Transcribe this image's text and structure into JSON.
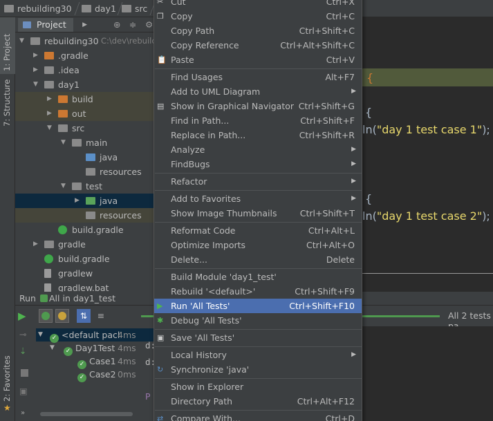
{
  "breadcrumbs": [
    "rebuilding30",
    "day1",
    "src"
  ],
  "tool_windows": {
    "project": "1: Project",
    "structure": "7: Structure",
    "favorites": "2: Favorites"
  },
  "project_panel": {
    "tab_label": "Project",
    "tree": [
      {
        "label": "rebuilding30",
        "path": "C:\\dev\\rebuild",
        "icon": "module-folder-icon"
      },
      {
        "label": ".gradle",
        "icon": "orange-folder-icon"
      },
      {
        "label": ".idea",
        "icon": "folder-icon"
      },
      {
        "label": "day1",
        "icon": "folder-icon"
      },
      {
        "label": "build",
        "icon": "orange-folder-icon"
      },
      {
        "label": "out",
        "icon": "orange-folder-icon"
      },
      {
        "label": "src",
        "icon": "folder-icon"
      },
      {
        "label": "main",
        "icon": "folder-icon"
      },
      {
        "label": "java",
        "icon": "blue-source-folder-icon"
      },
      {
        "label": "resources",
        "icon": "resources-folder-icon"
      },
      {
        "label": "test",
        "icon": "folder-icon"
      },
      {
        "label": "java",
        "icon": "green-test-folder-icon"
      },
      {
        "label": "resources",
        "icon": "resources-folder-icon"
      },
      {
        "label": "build.gradle",
        "icon": "gradle-icon"
      },
      {
        "label": "gradle",
        "icon": "folder-icon"
      },
      {
        "label": "build.gradle",
        "icon": "gradle-icon"
      },
      {
        "label": "gradlew",
        "icon": "file-icon"
      },
      {
        "label": "gradlew.bat",
        "icon": "file-icon"
      }
    ]
  },
  "editor": {
    "lines": [
      {
        "text": "{",
        "kind": "brace-highlight"
      },
      {
        "text": "{",
        "kind": "code"
      },
      {
        "prefix": "ln(",
        "string": "\"day 1 test case 1\"",
        "suffix": ");"
      },
      {
        "text": "{",
        "kind": "code"
      },
      {
        "prefix": "ln(",
        "string": "\"day 1 test case 2\"",
        "suffix": ");"
      }
    ]
  },
  "run_panel": {
    "title_prefix": "Run",
    "title": "All in day1_test",
    "status": "All 2 tests pa",
    "tests": [
      {
        "label": "<default pacl",
        "duration": "4ms"
      },
      {
        "label": "Day1Test",
        "duration": "4ms"
      },
      {
        "label": "Case1",
        "duration": "4ms"
      },
      {
        "label": "Case2",
        "duration": "0ms"
      }
    ],
    "console_lines": [
      "d:",
      "d:",
      "P"
    ]
  },
  "context_menu": {
    "items": [
      {
        "label": "Cut",
        "shortcut": "Ctrl+X",
        "icon": "scissors-icon"
      },
      {
        "label": "Copy",
        "shortcut": "Ctrl+C",
        "icon": "copy-icon"
      },
      {
        "label": "Copy Path",
        "shortcut": "Ctrl+Shift+C"
      },
      {
        "label": "Copy Reference",
        "shortcut": "Ctrl+Alt+Shift+C"
      },
      {
        "label": "Paste",
        "shortcut": "Ctrl+V",
        "icon": "paste-icon"
      },
      {
        "separator": true
      },
      {
        "label": "Find Usages",
        "shortcut": "Alt+F7"
      },
      {
        "label": "Add to UML Diagram",
        "submenu": true
      },
      {
        "label": "Show in Graphical Navigator",
        "shortcut": "Ctrl+Shift+G",
        "icon": "graph-navigator-icon"
      },
      {
        "label": "Find in Path...",
        "shortcut": "Ctrl+Shift+F"
      },
      {
        "label": "Replace in Path...",
        "shortcut": "Ctrl+Shift+R"
      },
      {
        "label": "Analyze",
        "submenu": true
      },
      {
        "label": "FindBugs",
        "submenu": true
      },
      {
        "separator": true
      },
      {
        "label": "Refactor",
        "submenu": true
      },
      {
        "separator": true
      },
      {
        "label": "Add to Favorites",
        "submenu": true
      },
      {
        "label": "Show Image Thumbnails",
        "shortcut": "Ctrl+Shift+T"
      },
      {
        "separator": true
      },
      {
        "label": "Reformat Code",
        "shortcut": "Ctrl+Alt+L"
      },
      {
        "label": "Optimize Imports",
        "shortcut": "Ctrl+Alt+O"
      },
      {
        "label": "Delete...",
        "shortcut": "Delete"
      },
      {
        "separator": true
      },
      {
        "label": "Build Module 'day1_test'"
      },
      {
        "label": "Rebuild '<default>'",
        "shortcut": "Ctrl+Shift+F9"
      },
      {
        "label": "Run 'All Tests'",
        "shortcut": "Ctrl+Shift+F10",
        "icon": "run-icon",
        "selected": true
      },
      {
        "label": "Debug 'All Tests'",
        "icon": "debug-icon"
      },
      {
        "separator": true
      },
      {
        "label": "Save 'All Tests'",
        "icon": "save-config-icon"
      },
      {
        "separator": true
      },
      {
        "label": "Local History",
        "submenu": true
      },
      {
        "label": "Synchronize 'java'",
        "icon": "sync-icon"
      },
      {
        "separator": true
      },
      {
        "label": "Show in Explorer"
      },
      {
        "label": "Directory Path",
        "shortcut": "Ctrl+Alt+F12"
      },
      {
        "separator": true
      },
      {
        "label": "Compare With...",
        "shortcut": "Ctrl+D",
        "icon": "compare-icon"
      }
    ]
  },
  "colors": {
    "menu_bg": "#3c3f41",
    "menu_selected": "#4b6eaf",
    "tree_selected": "#0d293e",
    "string_literal": "#e8d86c",
    "test_pass": "#4f9a4f",
    "excluded_folder": "#cc7832"
  }
}
